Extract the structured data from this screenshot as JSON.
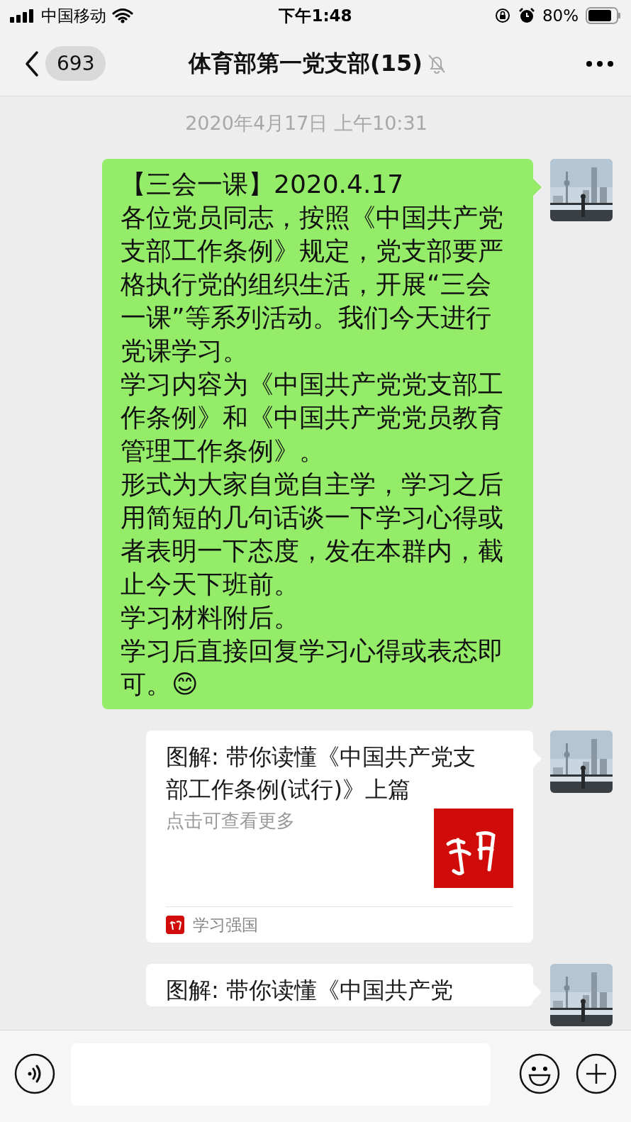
{
  "status_bar": {
    "carrier": "中国移动",
    "time": "下午1:48",
    "battery": "80%"
  },
  "nav": {
    "unread": "693",
    "title": "体育部第一党支部(15)",
    "muted": true
  },
  "timestamp": "2020年4月17日 上午10:31",
  "messages": [
    {
      "kind": "text",
      "paragraphs": [
        "【三会一课】2020.4.17",
        "各位党员同志，按照《中国共产党支部工作条例》规定，党支部要严格执行党的组织生活，开展“三会一课”等系列活动。我们今天进行党课学习。",
        "学习内容为《中国共产党党支部工作条例》和《中国共产党党员教育管理工作条例》。",
        "形式为大家自觉自主学，学习之后用简短的几句话谈一下学习心得或者表明一下态度，发在本群内，截止今天下班前。",
        "学习材料附后。",
        "学习后直接回复学习心得或表态即可。😊"
      ]
    },
    {
      "kind": "link",
      "title": "图解: 带你读懂《中国共产党支部工作条例(试行)》上篇",
      "description": "点击可查看更多",
      "source": "学习强国"
    },
    {
      "kind": "link",
      "title": "图解: 带你读懂《中国共产党"
    }
  ]
}
